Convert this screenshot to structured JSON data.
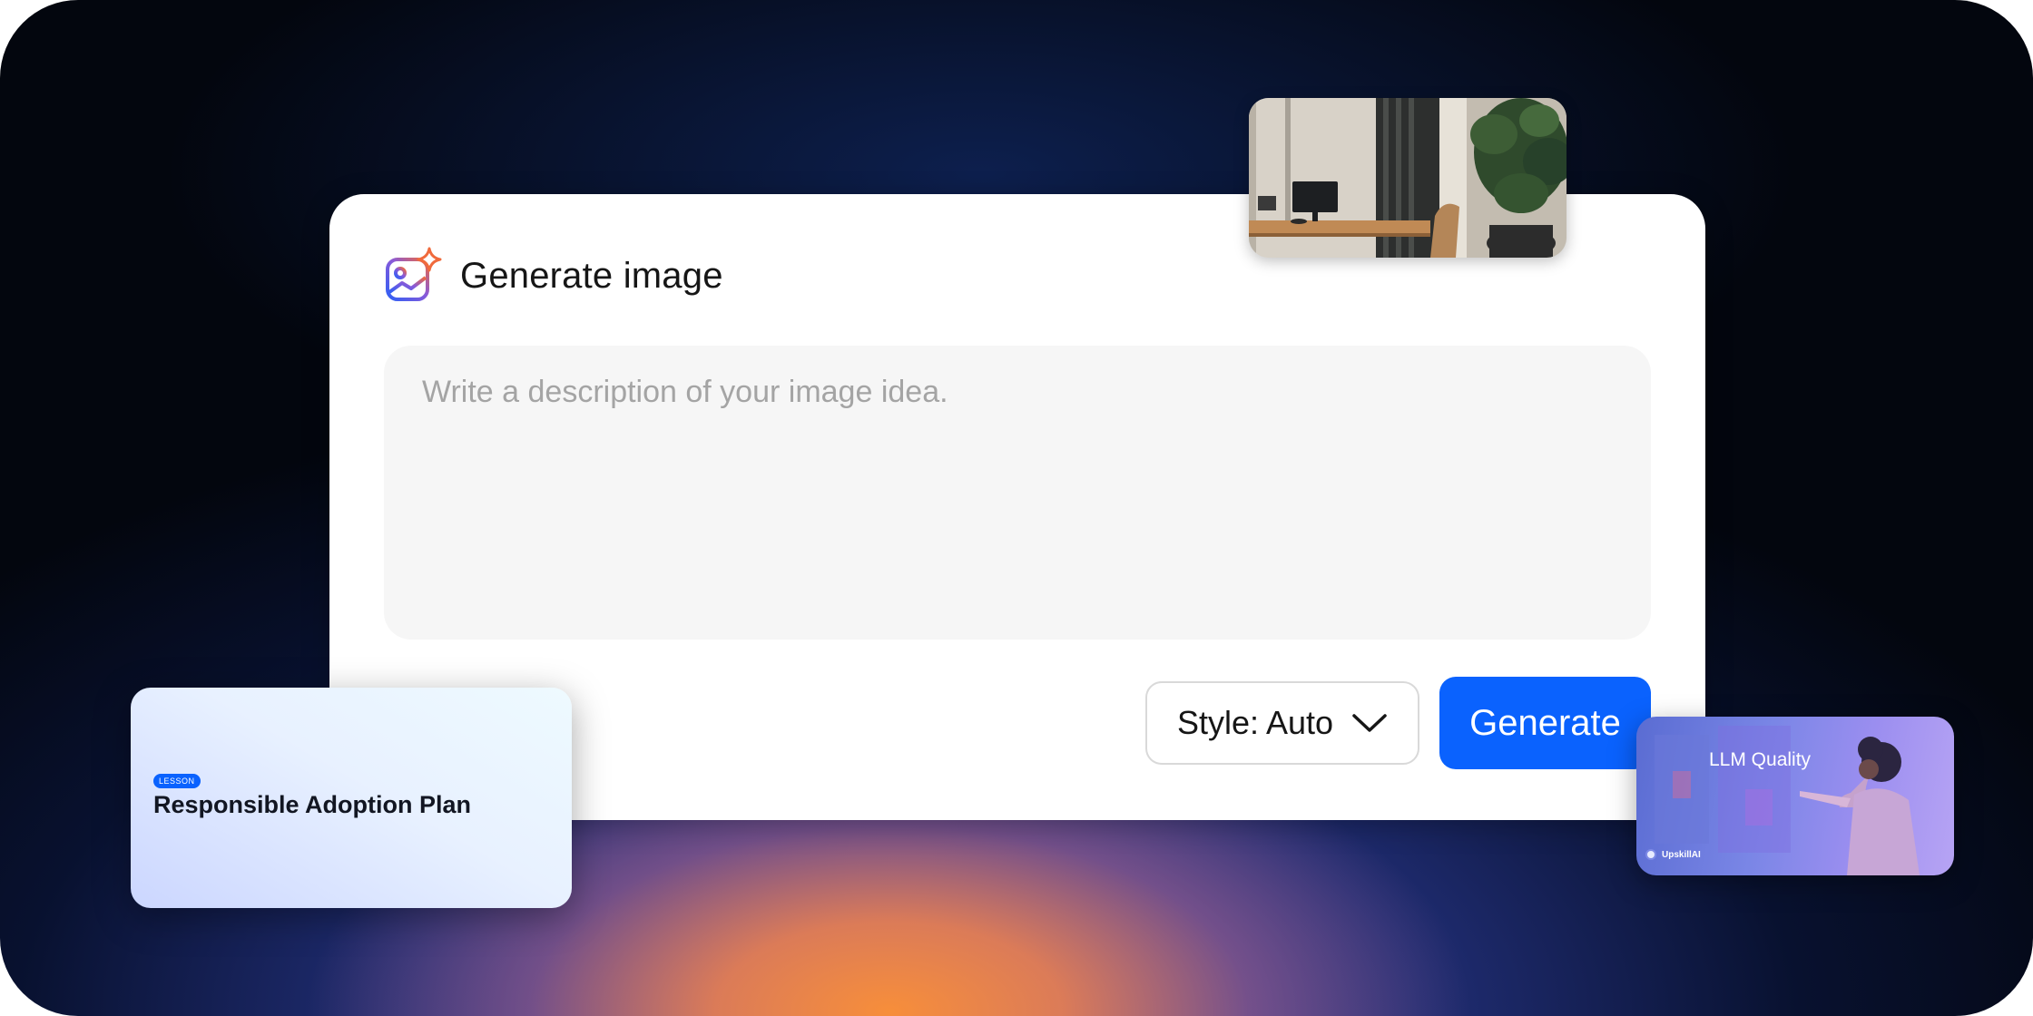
{
  "generator": {
    "title": "Generate image",
    "icon": "image-sparkle-icon",
    "prompt_placeholder": "Write a description of your image idea.",
    "style_select": {
      "label": "Style: Auto",
      "icon": "chevron-down-icon"
    },
    "generate_label": "Generate",
    "accent": "#0a62fe"
  },
  "lesson_card": {
    "badge": "LESSON",
    "title": "Responsible Adoption Plan"
  },
  "llm_card": {
    "title": "LLM Quality",
    "brand": "UpskillAI"
  }
}
